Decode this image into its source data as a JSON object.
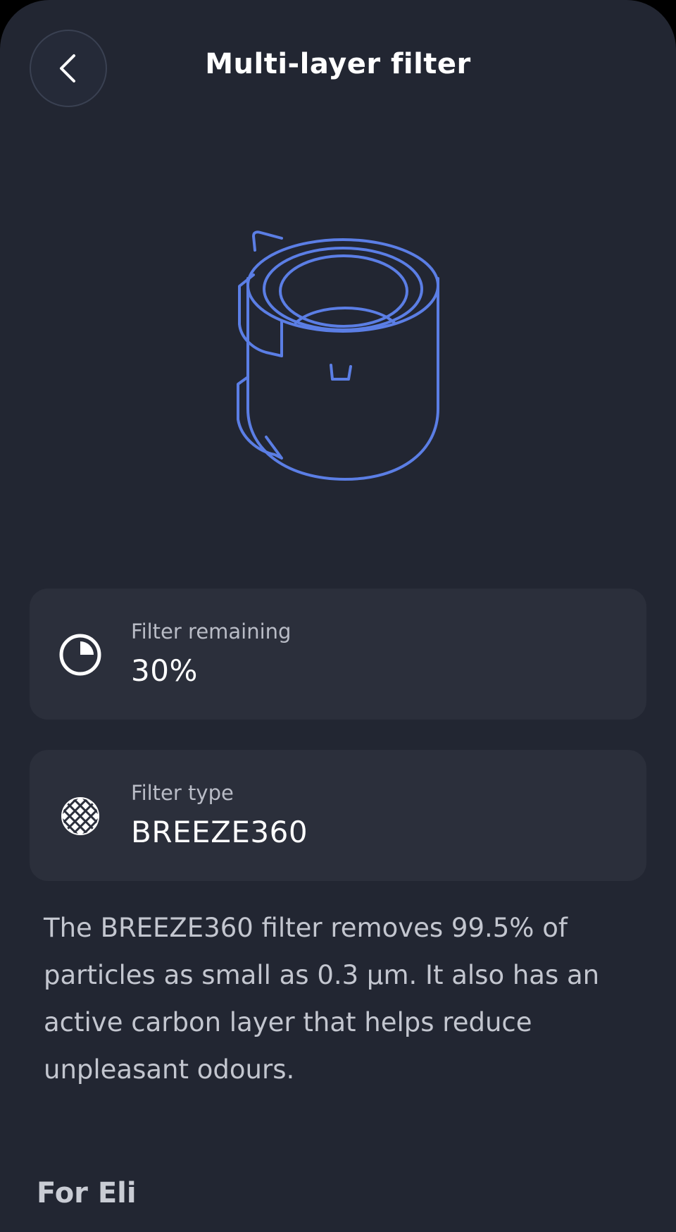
{
  "header": {
    "title": "Multi-layer filter",
    "back_icon": "chevron-left-icon"
  },
  "illustration": {
    "icon": "filter-cylinder-illustration",
    "stroke_color": "#5b7ee5"
  },
  "filter_remaining": {
    "icon": "pie-clock-icon",
    "label": "Filter remaining",
    "value": "30%"
  },
  "filter_type": {
    "icon": "mesh-filter-icon",
    "label": "Filter type",
    "value": "BREEZE360"
  },
  "description": "The BREEZE360 filter removes 99.5% of particles as small as 0.3 µm. It also has an active carbon layer that helps reduce unpleasant odours.",
  "section": {
    "heading": "For Eli"
  },
  "colors": {
    "background": "#222632",
    "card": "#2b2f3b",
    "accent": "#5b7ee5"
  }
}
